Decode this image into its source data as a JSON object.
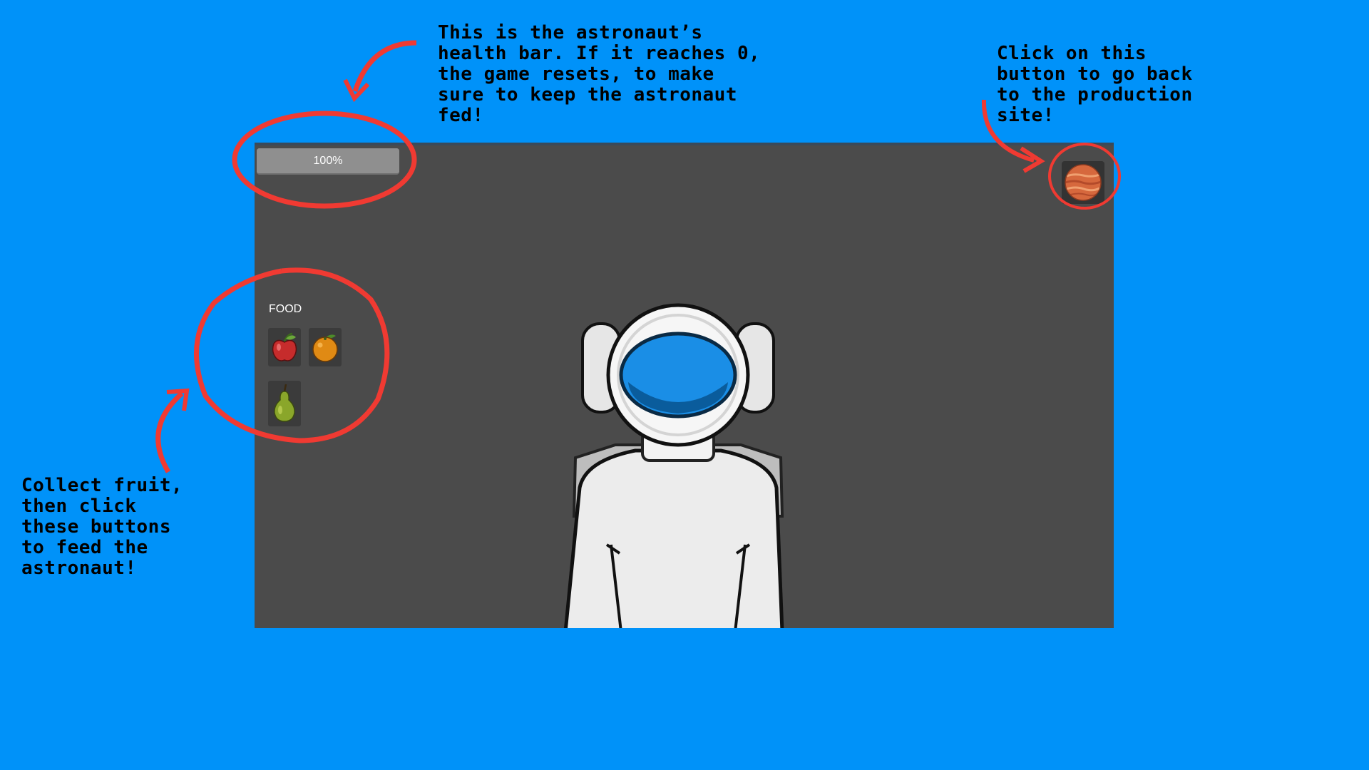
{
  "annotations": {
    "health_note": "This is the astronaut’s\nhealth bar. If it reaches 0,\nthe game resets, to make\nsure to keep the astronaut\nfed!",
    "planet_note": "Click on this\nbutton to go back\nto the production\nsite!",
    "food_note": "Collect fruit,\nthen click\nthese buttons\nto feed the\nastronaut!"
  },
  "game": {
    "health": {
      "label": "100%",
      "percent": 100
    },
    "planet_button": {
      "icon": "planet-icon"
    },
    "food": {
      "label": "FOOD",
      "items": [
        {
          "name": "apple",
          "icon": "apple-icon"
        },
        {
          "name": "orange",
          "icon": "orange-icon"
        },
        {
          "name": "pear",
          "icon": "pear-icon"
        }
      ]
    }
  },
  "colors": {
    "background": "#0092f9",
    "game_bg": "#4b4b4b",
    "annotation_red": "#f03a32",
    "visor": "#1a8ee6"
  }
}
